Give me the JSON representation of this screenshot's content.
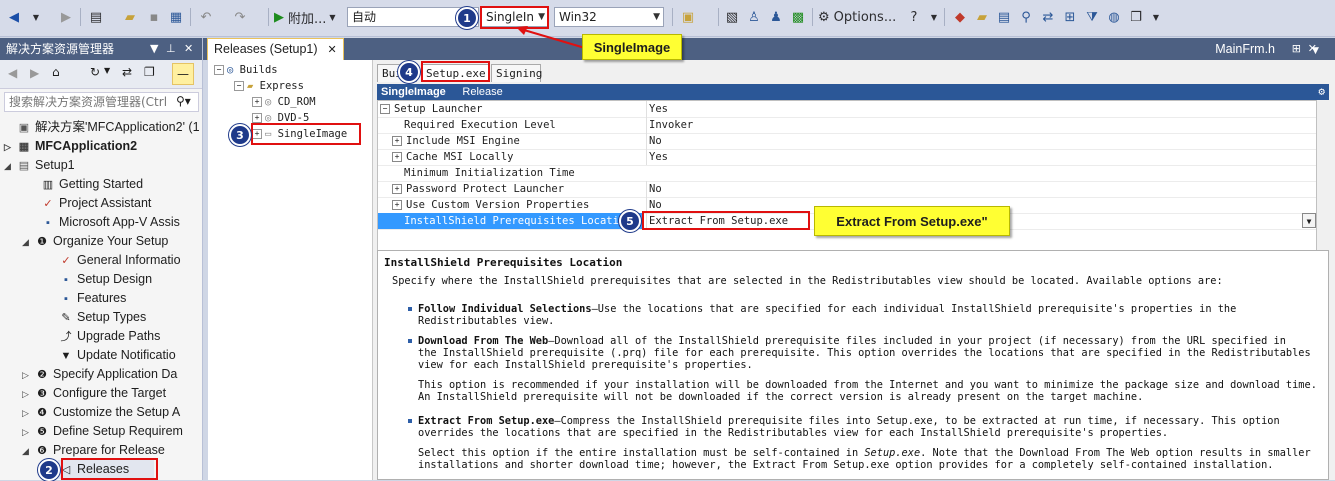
{
  "toolbar": {
    "attach_label": "附加...",
    "config_value": "自动",
    "release_value": "SingleIn",
    "platform_value": "Win32",
    "options_label": "Options..."
  },
  "solution_explorer": {
    "title": "解决方案资源管理器",
    "search_placeholder": "搜索解决方案资源管理器(Ctrl",
    "items": [
      {
        "label": "解决方案'MFCApplication2' (1"
      },
      {
        "label": "MFCApplication2"
      },
      {
        "label": "Setup1"
      },
      {
        "label": "Getting Started"
      },
      {
        "label": "Project Assistant"
      },
      {
        "label": "Microsoft App-V Assis"
      },
      {
        "label": "Organize Your Setup"
      },
      {
        "label": "General Informatio"
      },
      {
        "label": "Setup Design"
      },
      {
        "label": "Features"
      },
      {
        "label": "Setup Types"
      },
      {
        "label": "Upgrade Paths"
      },
      {
        "label": "Update Notificatio"
      },
      {
        "label": "Specify Application Da"
      },
      {
        "label": "Configure the Target"
      },
      {
        "label": "Customize the Setup A"
      },
      {
        "label": "Define Setup Requirem"
      },
      {
        "label": "Prepare for Release"
      },
      {
        "label": "Releases"
      }
    ]
  },
  "doc_tab": {
    "label": "Releases (Setup1)",
    "right_tab": "MainFrm.h"
  },
  "release_tree": {
    "items": [
      {
        "label": "Builds"
      },
      {
        "label": "Express"
      },
      {
        "label": "CD_ROM"
      },
      {
        "label": "DVD-5"
      },
      {
        "label": "SingleImage"
      }
    ]
  },
  "subtabs": {
    "build": "Bui",
    "setup_exe": "Setup.exe",
    "signing": "Signing"
  },
  "header_bar": {
    "name": "SingleImage",
    "config": "Release"
  },
  "properties": [
    {
      "name": "Setup Launcher",
      "value": "Yes"
    },
    {
      "name": "Required Execution Level",
      "value": "Invoker"
    },
    {
      "name": "Include MSI Engine",
      "value": "No"
    },
    {
      "name": "Cache MSI Locally",
      "value": "Yes"
    },
    {
      "name": "Minimum Initialization Time",
      "value": ""
    },
    {
      "name": "Password Protect Launcher",
      "value": "No"
    },
    {
      "name": "Use Custom Version Properties",
      "value": "No"
    },
    {
      "name": "InstallShield Prerequisites Location",
      "value": "Extract From Setup.exe"
    }
  ],
  "annotations": {
    "badges": [
      "1",
      "2",
      "3",
      "4",
      "5"
    ],
    "callout_single": "SingleImage",
    "callout_extract": "Extract From Setup.exe\""
  },
  "help": {
    "title": "InstallShield Prerequisites Location",
    "intro": "Specify where the InstallShield prerequisites that are selected in the Redistributables view should be located. Available options are:",
    "b1_title": "Follow Individual Selections",
    "b1_l1": "—Use the locations that are specified for each individual InstallShield prerequisite's properties in the",
    "b1_l2": "Redistributables view.",
    "b2_title": "Download From The Web",
    "b2_l1": "—Download all of the InstallShield prerequisite files included in your project (if necessary) from the URL specified in",
    "b2_l2": "the InstallShield prerequisite (.prq) file for each prerequisite. This option overrides the locations that are specified in the Redistributables",
    "b2_l3": "view for each InstallShield prerequisite's properties.",
    "b2_p2_l1": "This option is recommended if your installation will be downloaded from the Internet and you want to minimize the package size and download time.",
    "b2_p2_l2": "An InstallShield prerequisite will not be downloaded if the correct version is already present on the target machine.",
    "b3_title": "Extract From Setup.exe",
    "b3_l1": "—Compress the InstallShield prerequisite files into Setup.exe, to be extracted at run time, if necessary. This option",
    "b3_l2": "overrides the locations that are specified in the Redistributables view for each InstallShield prerequisite's properties.",
    "b3_p2_l1a": "Select this option if the entire installation must be self-contained in",
    "b3_p2_l1b": "Setup.exe",
    "b3_p2_l1c": ". Note that the Download From The Web option results in smaller",
    "b3_p2_l2": "installations and shorter download time; however, the Extract From Setup.exe option provides for a completely self-contained installation."
  }
}
